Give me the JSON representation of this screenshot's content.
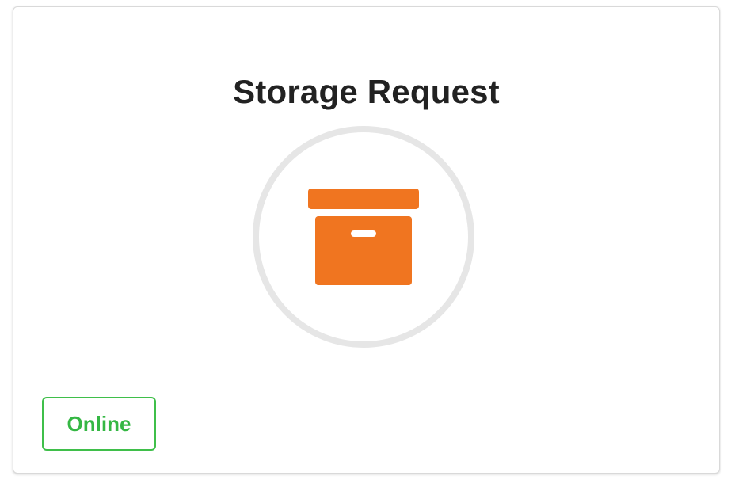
{
  "card": {
    "title": "Storage Request",
    "icon": "archive-box-icon",
    "status_label": "Online"
  },
  "colors": {
    "icon_accent": "#f07520",
    "status_green": "#3fbf4a",
    "ring_gray": "#e6e6e6"
  }
}
